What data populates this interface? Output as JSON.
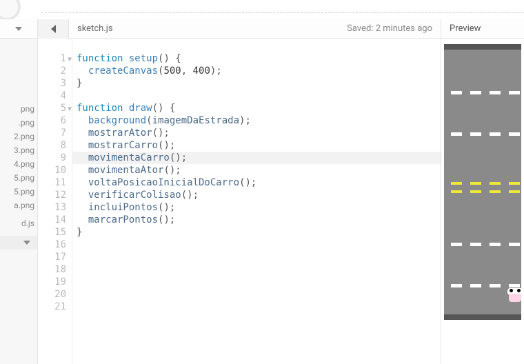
{
  "header": {
    "filename": "sketch.js",
    "saved_status": "Saved: 2 minutes ago",
    "preview_label": "Preview"
  },
  "sidebar": {
    "files": [
      "png",
      ".png",
      "2.png",
      "3.png",
      "4.png",
      "5.png",
      "5.png",
      "a.png",
      "",
      "d.js"
    ]
  },
  "code": {
    "lines": [
      {
        "n": 1,
        "fold": true,
        "tokens": [
          {
            "t": "function ",
            "c": "kw"
          },
          {
            "t": "setup",
            "c": "fn"
          },
          {
            "t": "() {",
            "c": "plain"
          }
        ]
      },
      {
        "n": 2,
        "tokens": [
          {
            "t": "  ",
            "c": "plain"
          },
          {
            "t": "createCanvas",
            "c": "fn"
          },
          {
            "t": "(",
            "c": "plain"
          },
          {
            "t": "500",
            "c": "num"
          },
          {
            "t": ", ",
            "c": "plain"
          },
          {
            "t": "400",
            "c": "num"
          },
          {
            "t": ");",
            "c": "plain"
          }
        ]
      },
      {
        "n": 3,
        "tokens": [
          {
            "t": "}",
            "c": "plain"
          }
        ]
      },
      {
        "n": 4,
        "tokens": []
      },
      {
        "n": 5,
        "fold": true,
        "tokens": [
          {
            "t": "function ",
            "c": "kw"
          },
          {
            "t": "draw",
            "c": "fn"
          },
          {
            "t": "() {",
            "c": "plain"
          }
        ]
      },
      {
        "n": 6,
        "tokens": [
          {
            "t": "  ",
            "c": "plain"
          },
          {
            "t": "background",
            "c": "fn"
          },
          {
            "t": "(",
            "c": "plain"
          },
          {
            "t": "imagemDaEstrada",
            "c": "ident"
          },
          {
            "t": ");",
            "c": "plain"
          }
        ]
      },
      {
        "n": 7,
        "tokens": [
          {
            "t": "  ",
            "c": "plain"
          },
          {
            "t": "mostrarAtor",
            "c": "ident"
          },
          {
            "t": "();",
            "c": "plain"
          }
        ]
      },
      {
        "n": 8,
        "tokens": [
          {
            "t": "  ",
            "c": "plain"
          },
          {
            "t": "mostrarCarro",
            "c": "ident"
          },
          {
            "t": "();",
            "c": "plain"
          }
        ]
      },
      {
        "n": 9,
        "hl": true,
        "tokens": [
          {
            "t": "  ",
            "c": "plain"
          },
          {
            "t": "movimentaCarro",
            "c": "ident"
          },
          {
            "t": "();",
            "c": "plain"
          }
        ]
      },
      {
        "n": 10,
        "tokens": [
          {
            "t": "  ",
            "c": "plain"
          },
          {
            "t": "movimentaAtor",
            "c": "ident"
          },
          {
            "t": "();",
            "c": "plain"
          }
        ]
      },
      {
        "n": 11,
        "tokens": [
          {
            "t": "  ",
            "c": "plain"
          },
          {
            "t": "voltaPosicaoInicialDoCarro",
            "c": "ident"
          },
          {
            "t": "();",
            "c": "plain"
          }
        ]
      },
      {
        "n": 12,
        "tokens": [
          {
            "t": "  ",
            "c": "plain"
          },
          {
            "t": "verificarColisao",
            "c": "ident"
          },
          {
            "t": "();",
            "c": "plain"
          }
        ]
      },
      {
        "n": 13,
        "tokens": [
          {
            "t": "  ",
            "c": "plain"
          },
          {
            "t": "incluiPontos",
            "c": "ident"
          },
          {
            "t": "();",
            "c": "plain"
          }
        ]
      },
      {
        "n": 14,
        "tokens": [
          {
            "t": "  ",
            "c": "plain"
          },
          {
            "t": "marcarPontos",
            "c": "ident"
          },
          {
            "t": "();",
            "c": "plain"
          }
        ]
      },
      {
        "n": 15,
        "tokens": [
          {
            "t": "}",
            "c": "plain"
          }
        ]
      },
      {
        "n": 16,
        "tokens": []
      },
      {
        "n": 17,
        "tokens": []
      },
      {
        "n": 18,
        "tokens": []
      },
      {
        "n": 19,
        "tokens": []
      },
      {
        "n": 20,
        "tokens": []
      },
      {
        "n": 21,
        "tokens": []
      }
    ]
  },
  "preview": {
    "lane_positions_white": [
      60,
      120,
      280,
      340
    ],
    "lane_positions_yellow": [
      192,
      204
    ]
  }
}
